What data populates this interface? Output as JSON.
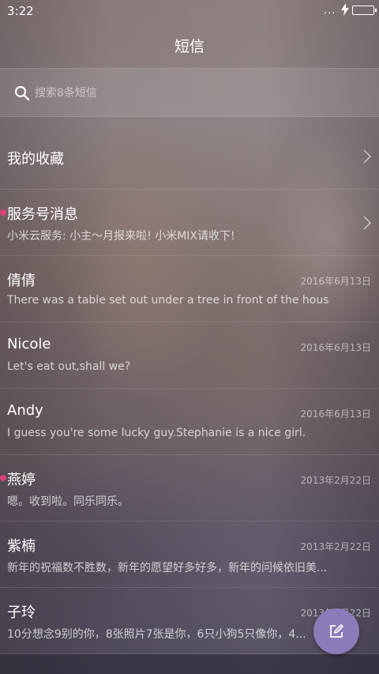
{
  "status_bar": {
    "time": "3:22",
    "dots": "...",
    "charging_icon": "bolt-icon"
  },
  "header": {
    "title": "短信"
  },
  "search": {
    "placeholder": "搜索8条短信",
    "icon": "search-icon"
  },
  "conversations": [
    {
      "title": "我的收藏",
      "preview": "",
      "date": "",
      "unread": false,
      "chevron": true
    },
    {
      "title": "服务号消息",
      "preview": "小米云服务: 小主～月报来啦! 小米MIX请收下!",
      "date": "",
      "unread": true,
      "chevron": true
    },
    {
      "title": "倩倩",
      "preview": "There was a table set out under a tree in front of the hous",
      "date": "2016年6月13日",
      "unread": false,
      "chevron": false
    },
    {
      "title": "Nicole",
      "preview": "Let's eat out,shall we?",
      "date": "2016年6月13日",
      "unread": false,
      "chevron": false
    },
    {
      "title": "Andy",
      "preview": "I guess you're some lucky guy.Stephanie is a nice girl.",
      "date": "2016年6月13日",
      "unread": false,
      "chevron": false
    },
    {
      "title": "燕婷",
      "preview": "嗯。收到啦。同乐同乐。",
      "date": "2013年2月22日",
      "unread": true,
      "chevron": false
    },
    {
      "title": "紫楠",
      "preview": "新年的祝福数不胜数，新年的愿望好多好多，新年的问候依旧美...",
      "date": "2013年2月22日",
      "unread": false,
      "chevron": false
    },
    {
      "title": "子玲",
      "preview": "10分想念9别的你，8张照片7张是你，6只小狗5只像你，4...",
      "date": "2013年2月22日",
      "unread": false,
      "chevron": false
    }
  ],
  "fab": {
    "icon": "compose-icon"
  },
  "colors": {
    "unread_dot": "#d8407f",
    "fab": "#8b7bb8"
  }
}
